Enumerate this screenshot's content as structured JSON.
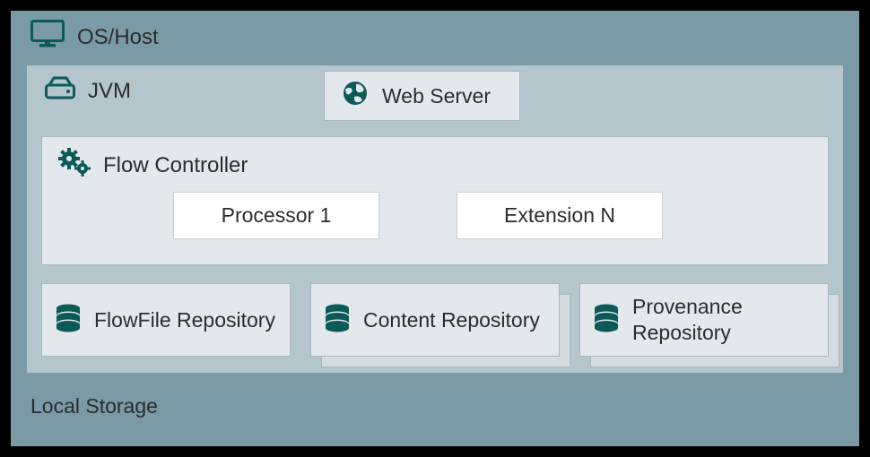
{
  "os_host": {
    "label": "OS/Host"
  },
  "jvm": {
    "label": "JVM"
  },
  "web_server": {
    "label": "Web Server"
  },
  "flow_controller": {
    "label": "Flow Controller",
    "processor": "Processor 1",
    "extension": "Extension N"
  },
  "repos": {
    "flowfile": "FlowFile Repository",
    "content": "Content Repository",
    "provenance": "Provenance Repository"
  },
  "local_storage": "Local Storage",
  "colors": {
    "icon": "#0b5a58"
  }
}
